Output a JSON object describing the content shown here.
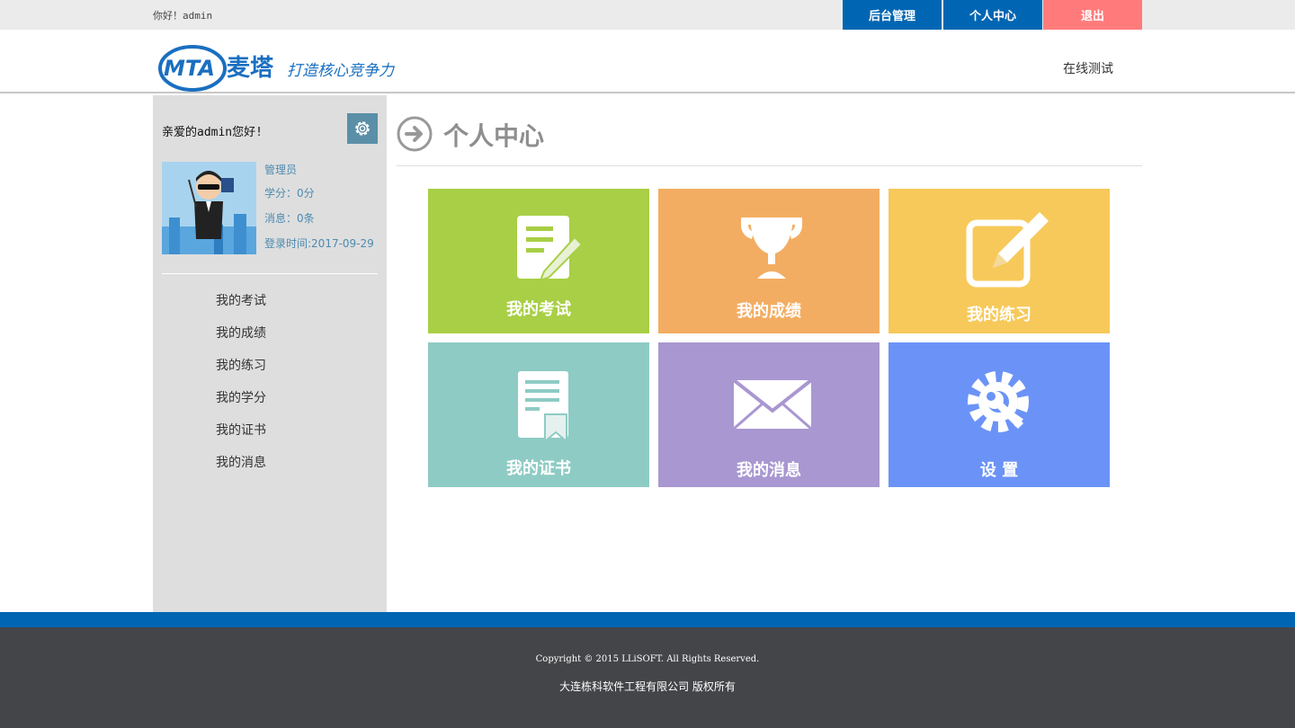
{
  "topbar": {
    "greeting": "你好！admin",
    "buttons": [
      "后台管理",
      "个人中心",
      "退出"
    ]
  },
  "header": {
    "logo_text": "MTA",
    "logo_name": "麦塔",
    "logo_slogan": "打造核心竞争力",
    "nav_link": "在线测试"
  },
  "sidebar": {
    "welcome": "亲爱的admin您好!",
    "role": "管理员",
    "credit": "学分：0分",
    "messages": "消息：0条",
    "login_time": "登录时间:2017-09-29",
    "menu": [
      "我的考试",
      "我的成绩",
      "我的练习",
      "我的学分",
      "我的证书",
      "我的消息"
    ]
  },
  "main": {
    "title": "个人中心",
    "tiles": [
      "我的考试",
      "我的成绩",
      "我的练习",
      "我的证书",
      "我的消息",
      "设 置"
    ]
  },
  "footer": {
    "copyright": "Copyright © 2015 LLiSOFT. All Rights Reserved.",
    "company": "大连栋科软件工程有限公司 版权所有"
  },
  "colors": {
    "brand_blue": "#0066b3",
    "logout_red": "#ff7b7b",
    "tile_exam": "#a8cf45",
    "tile_score": "#f3ad62",
    "tile_practice": "#f7c95a",
    "tile_cert": "#8ecbc4",
    "tile_message": "#a997d1",
    "tile_settings": "#6b93f7"
  },
  "icons": [
    "gear-icon",
    "arrow-right-circle-icon",
    "document-pen-icon",
    "trophy-icon",
    "edit-icon",
    "certificate-icon",
    "envelope-icon",
    "wrench-gear-icon"
  ]
}
